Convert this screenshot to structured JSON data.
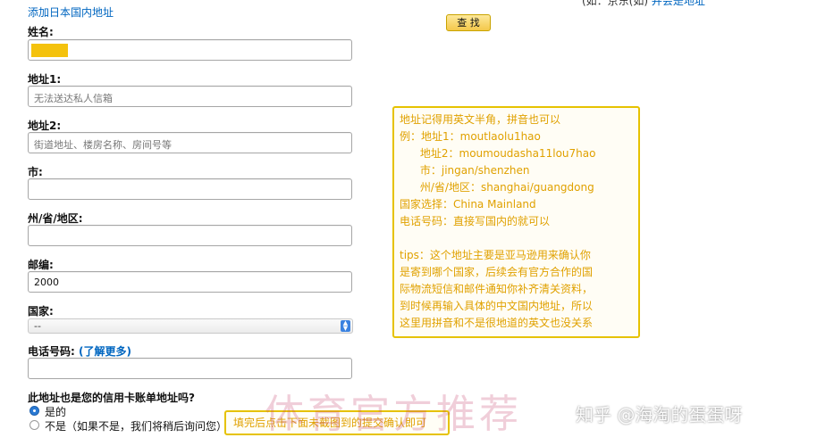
{
  "header": {
    "top_cut_text": "",
    "add_address_link": "添加日本国内地址",
    "right_hint_prefix": "(如：京东(如)",
    "right_hint_link": "并会是地址",
    "find_button": "查 找"
  },
  "form": {
    "name": {
      "label": "姓名:",
      "value": ""
    },
    "address1": {
      "label": "地址1:",
      "placeholder": "无法送达私人信箱"
    },
    "address2": {
      "label": "地址2:",
      "placeholder": "街道地址、楼房名称、房间号等"
    },
    "city": {
      "label": "市:",
      "value": ""
    },
    "state": {
      "label": "州/省/地区:",
      "value": ""
    },
    "postal": {
      "label": "邮编:",
      "value": "2000"
    },
    "country": {
      "label": "国家:",
      "selected": "--"
    },
    "phone": {
      "label": "电话号码:",
      "more_link": "(了解更多)",
      "value": ""
    },
    "billing": {
      "question": "此地址也是您的信用卡账单地址吗?",
      "option_yes": "是的",
      "option_no": "不是（如果不是，我们将稍后询问您）"
    }
  },
  "annotation": {
    "lines": [
      "地址记得用英文半角，拼音也可以",
      "例：地址1：moutlaolu1hao",
      "      地址2：moumoudasha11lou7hao",
      "      市：jingan/shenzhen",
      "      州/省/地区：shanghai/guangdong",
      "国家选择：China Mainland",
      "电话号码：直接写国内的就可以",
      "",
      "tips：这个地址主要是亚马逊用来确认你",
      "是寄到哪个国家，后续会有官方合作的国",
      "际物流短信和邮件通知你补齐清关资料，",
      "到时候再输入具体的中文国内地址，所以",
      "这里用拼音和不是很地道的英文也没关系"
    ],
    "confirm_note": "填完后点击下面未截图到的提交确认即可"
  },
  "watermark": "体育官方推荐",
  "brand_watermark": "知乎 @海淘的蛋蛋呀",
  "colors": {
    "accent_yellow": "#e6c200",
    "link_blue": "#0066c0",
    "name_highlight": "#f4c20d"
  }
}
